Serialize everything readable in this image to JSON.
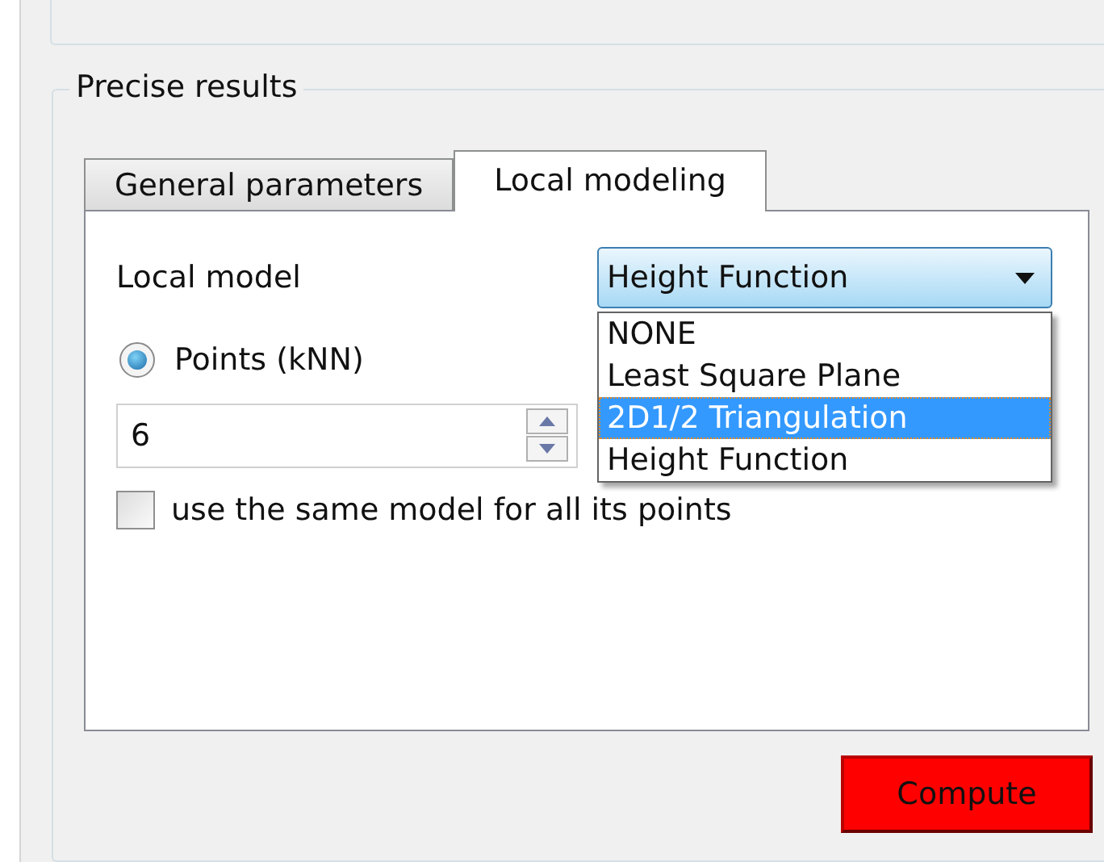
{
  "group": {
    "title": "Precise results"
  },
  "tabs": [
    {
      "label": "General parameters",
      "selected": false
    },
    {
      "label": "Local modeling",
      "selected": true
    }
  ],
  "local_model": {
    "label": "Local model",
    "value": "Height Function",
    "expanded": true,
    "options": [
      {
        "label": "NONE",
        "highlighted": false
      },
      {
        "label": "Least Square Plane",
        "highlighted": false
      },
      {
        "label": "2D1/2 Triangulation",
        "highlighted": true
      },
      {
        "label": "Height Function",
        "highlighted": false
      }
    ]
  },
  "neighbors": {
    "label": "Points (kNN)",
    "checked": true,
    "value": "6"
  },
  "same_model": {
    "label": "use the same model for all its points",
    "checked": false
  },
  "buttons": [
    {
      "label": "Compute"
    }
  ]
}
